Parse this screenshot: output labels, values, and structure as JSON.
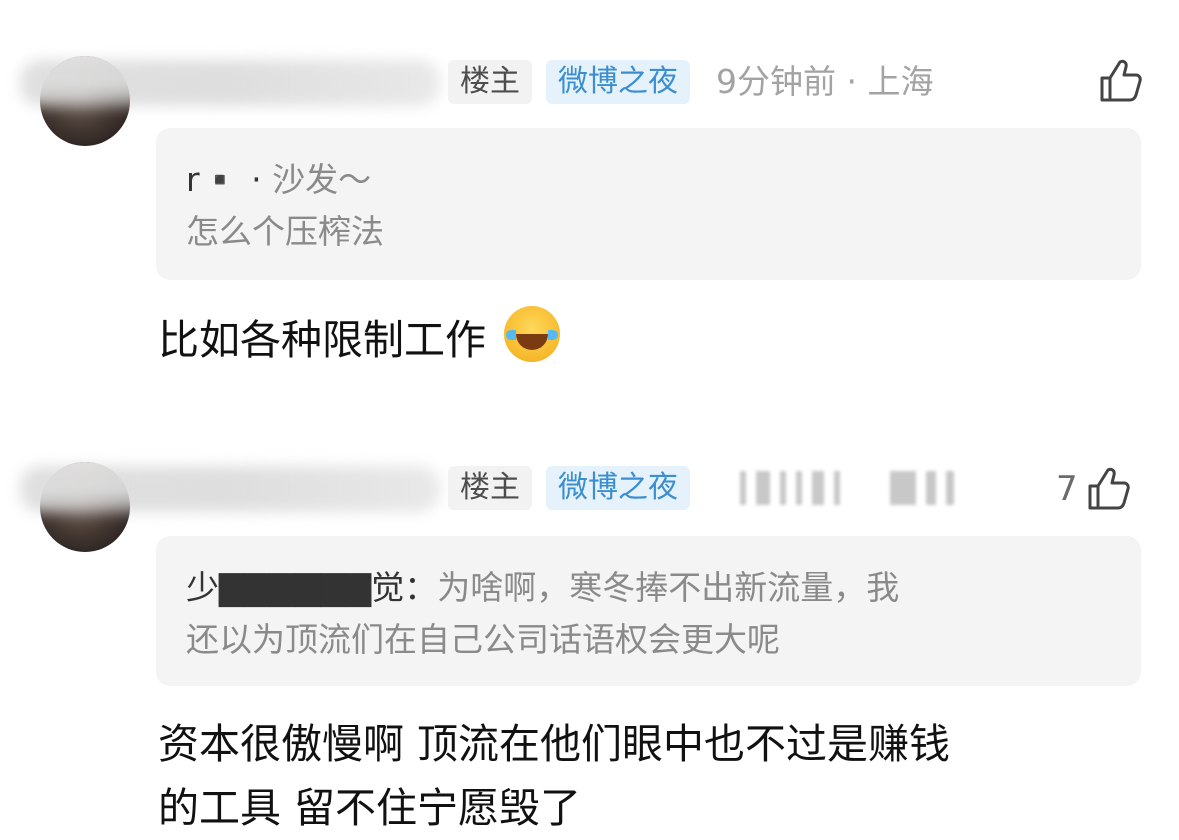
{
  "comments": [
    {
      "owner_tag": "楼主",
      "event_tag": "微博之夜",
      "meta": "9分钟前 · 上海",
      "like_count": "",
      "quote_name": "r▪️ · ",
      "quote_line1": "沙发～",
      "quote_line2": "怎么个压榨法",
      "reply_line1": "比如各种限制工作",
      "reply_line2": ""
    },
    {
      "owner_tag": "楼主",
      "event_tag": "微博之夜",
      "meta": "",
      "like_count": "7",
      "quote_name": "少▇▇▇▇▇▇觉：",
      "quote_line1": "为啥啊，寒冬捧不出新流量，我",
      "quote_line2": "还以为顶流们在自己公司话语权会更大呢",
      "reply_line1": "资本很傲慢啊 顶流在他们眼中也不过是赚钱",
      "reply_line2": "的工具 留不住宁愿毁了"
    }
  ],
  "icons": {
    "like": "thumbs-up-icon",
    "emoji": "laughing-tears-emoji"
  },
  "colors": {
    "event_tag_text": "#3b8fd1",
    "event_tag_bg": "#e6f2fb",
    "owner_tag_bg": "#f2f2f2",
    "quote_bg": "#f4f4f4",
    "meta_text": "#a3a3a3"
  }
}
